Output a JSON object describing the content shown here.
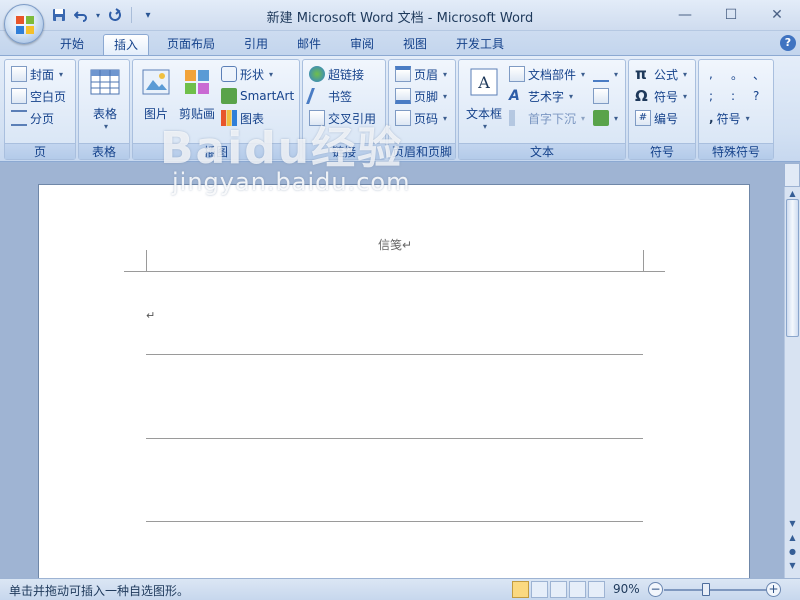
{
  "window": {
    "title": "新建 Microsoft Word 文档 - Microsoft Word",
    "controls": [
      "—",
      "☐",
      "✕"
    ]
  },
  "tabs": [
    "开始",
    "插入",
    "页面布局",
    "引用",
    "邮件",
    "审阅",
    "视图",
    "开发工具"
  ],
  "active_tab": "插入",
  "ribbon": {
    "pages": {
      "label": "页",
      "cover": "封面",
      "blank": "空白页",
      "break": "分页"
    },
    "tables": {
      "label": "表格",
      "table": "表格"
    },
    "illustrations": {
      "label": "插图",
      "picture": "图片",
      "clipart": "剪贴画",
      "shapes": "形状",
      "smartart": "SmartArt",
      "chart": "图表"
    },
    "links": {
      "label": "链接",
      "hyperlink": "超链接",
      "bookmark": "书签",
      "crossref": "交叉引用"
    },
    "header_footer": {
      "label": "页眉和页脚",
      "header": "页眉",
      "footer": "页脚",
      "pagenum": "页码"
    },
    "text": {
      "label": "文本",
      "textbox": "文本框",
      "quickparts": "文档部件",
      "wordart": "艺术字",
      "dropcap": "首字下沉"
    },
    "symbols": {
      "label": "符号",
      "equation": "公式",
      "symbol": "符号",
      "numbering": "编号"
    },
    "special": {
      "label": "特殊符号",
      "chars": [
        ",",
        "。",
        "、",
        ";",
        ":",
        "?"
      ],
      "symbol": "符号"
    }
  },
  "document": {
    "header_text": "信笺↵",
    "para_mark": "↵"
  },
  "watermark": {
    "line1": "Baidu经验",
    "line2": "jingyan.baidu.com"
  },
  "status": {
    "message": "单击并拖动可插入一种自选图形。",
    "zoom": "90%",
    "zoom_level_percent": 90
  }
}
